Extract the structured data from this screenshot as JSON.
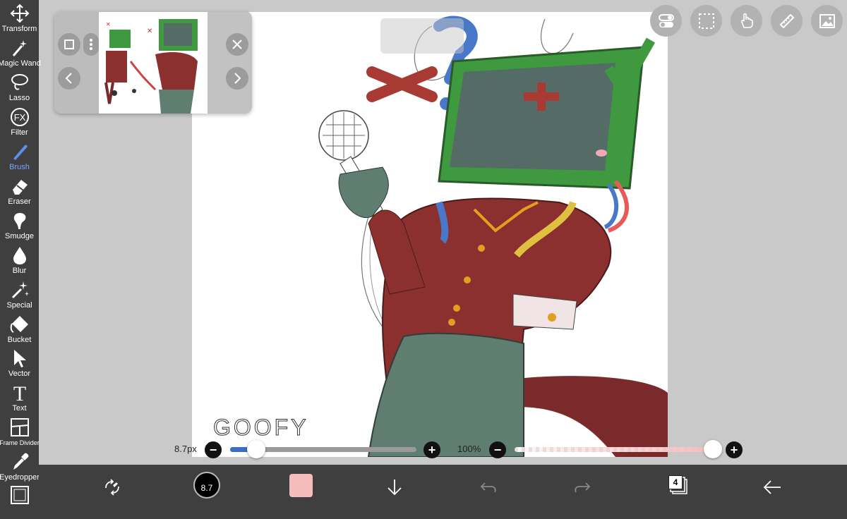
{
  "toolbar": {
    "items": [
      {
        "label": "Transform",
        "icon": "move-arrows-icon"
      },
      {
        "label": "Magic Wand",
        "icon": "magic-wand-icon"
      },
      {
        "label": "Lasso",
        "icon": "lasso-icon"
      },
      {
        "label": "Filter",
        "icon": "fx-icon"
      },
      {
        "label": "Brush",
        "icon": "brush-icon",
        "active": true
      },
      {
        "label": "Eraser",
        "icon": "eraser-icon"
      },
      {
        "label": "Smudge",
        "icon": "smudge-icon"
      },
      {
        "label": "Blur",
        "icon": "droplet-icon"
      },
      {
        "label": "Special",
        "icon": "sparkle-icon"
      },
      {
        "label": "Bucket",
        "icon": "bucket-icon"
      },
      {
        "label": "Vector",
        "icon": "cursor-arrow-icon"
      },
      {
        "label": "Text",
        "icon": "text-t-icon"
      },
      {
        "label": "Frame Divider",
        "icon": "frame-divider-icon"
      },
      {
        "label": "Eyedropper",
        "icon": "eyedropper-icon"
      },
      {
        "label": "",
        "icon": "canvas-frame-icon"
      }
    ],
    "fx_glyph": "FX",
    "text_glyph": "T",
    "active_color": "#7aa7ff"
  },
  "canvas": {
    "handwriting": "GOOFY"
  },
  "sliders": {
    "brush_size_label": "8.7px",
    "brush_size_fraction": 0.12,
    "opacity_label": "100%",
    "opacity_fraction": 1.0,
    "minus_glyph": "−",
    "plus_glyph": "+"
  },
  "bottombar": {
    "brush_size_value": "8.7",
    "current_color": "#f4bcbc",
    "layer_count": "4"
  },
  "colors": {
    "toolbar_bg": "#3f3f3f",
    "workspace_bg": "#c9c9c9",
    "accent_blue": "#3a6fc4"
  }
}
